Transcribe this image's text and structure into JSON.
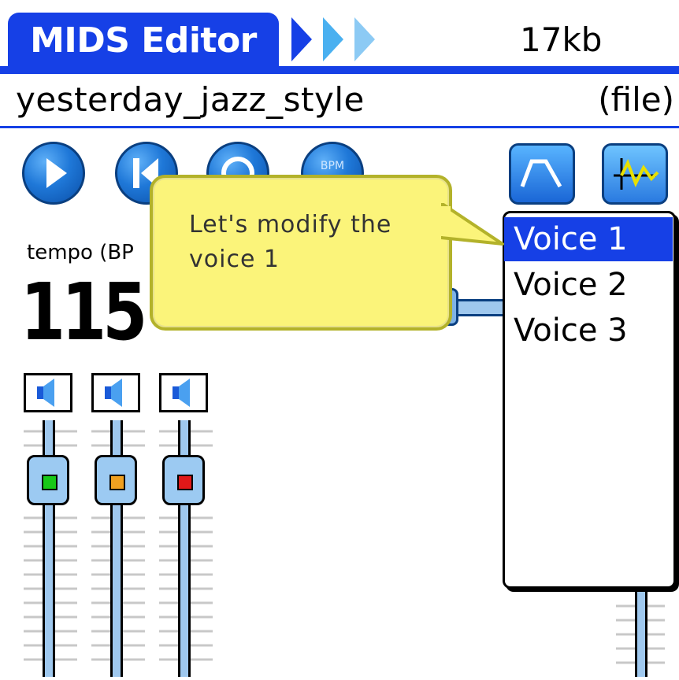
{
  "app": {
    "title": "MIDS Editor",
    "file_size": "17kb",
    "file_name": "yesterday_jazz_style",
    "file_type": "(file)"
  },
  "toolbar": {
    "buttons": [
      {
        "name": "play",
        "icon": "play-icon"
      },
      {
        "name": "rewind",
        "icon": "rewind-icon"
      },
      {
        "name": "loop",
        "icon": "loop-icon"
      },
      {
        "name": "bpm",
        "icon": "bpm-icon",
        "label": "BPM"
      },
      {
        "name": "envelope",
        "icon": "envelope-icon"
      },
      {
        "name": "waveform",
        "icon": "waveform-icon"
      }
    ]
  },
  "tempo": {
    "label": "tempo (BP",
    "value": "115"
  },
  "callout": {
    "text": "Let's modify the voice 1"
  },
  "voices": {
    "items": [
      "Voice 1",
      "Voice 2",
      "Voice 3"
    ],
    "selected_index": 0
  },
  "channels": [
    {
      "led_color": "#18c818"
    },
    {
      "led_color": "#f0a020"
    },
    {
      "led_color": "#e01818"
    }
  ],
  "colors": {
    "accent": "#1640e6",
    "callout_bg": "#fbf47a"
  }
}
